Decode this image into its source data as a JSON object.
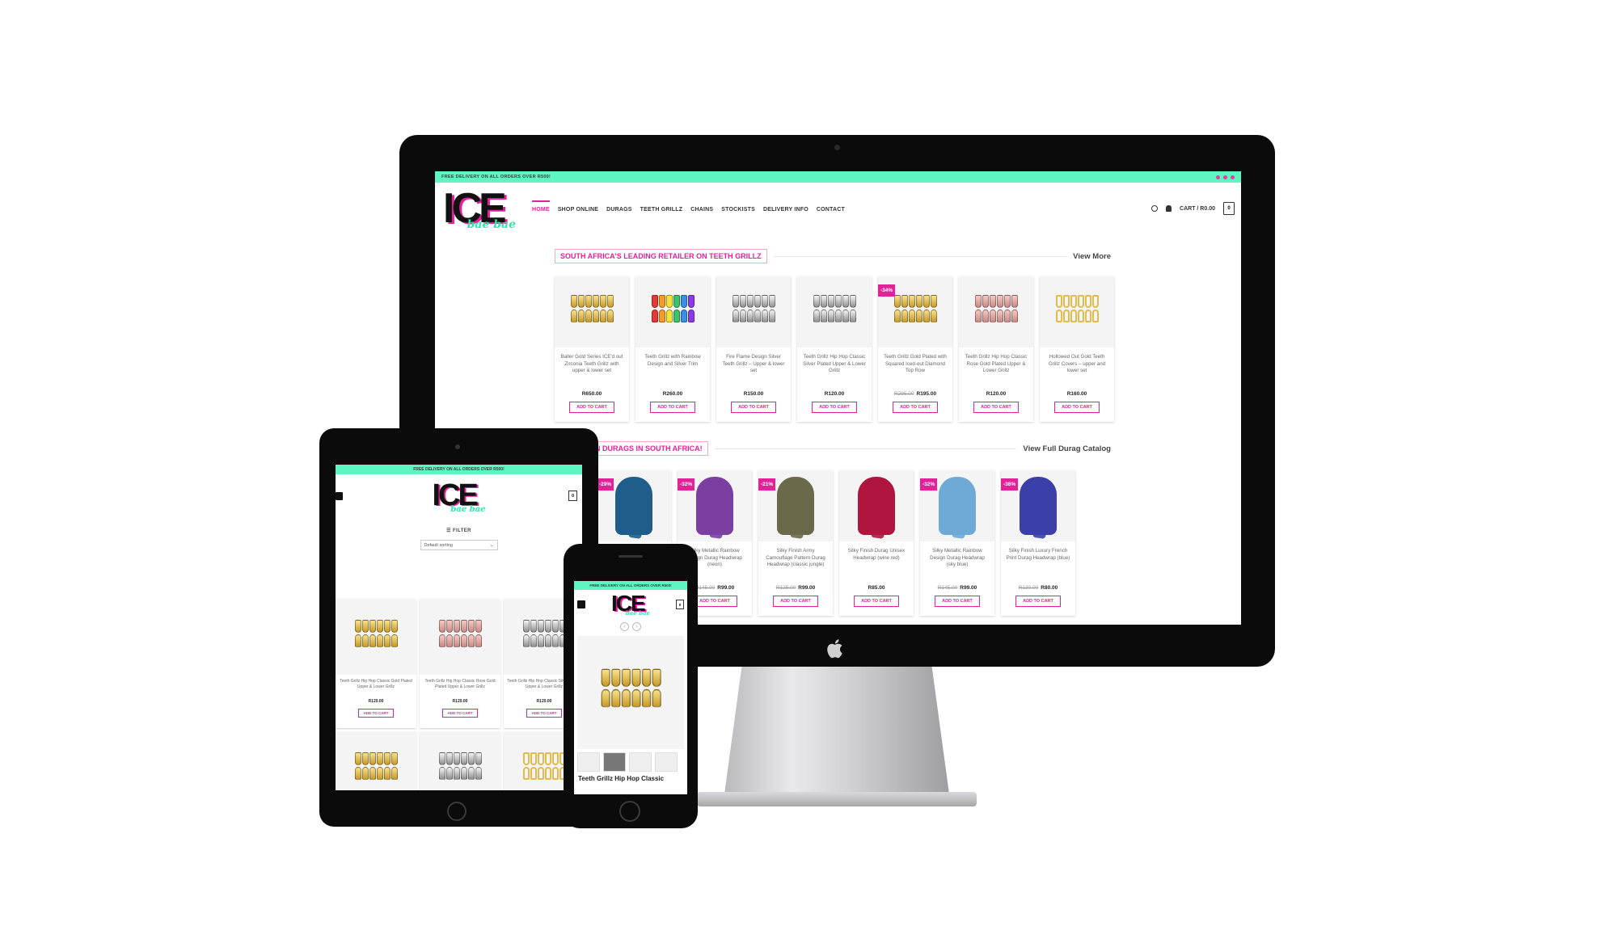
{
  "desktop": {
    "topbar": {
      "promo": "FREE DELIVERY ON ALL ORDERS OVER R500!"
    },
    "logo": {
      "word": "ICE",
      "script": "bae bae"
    },
    "nav": [
      "HOME",
      "SHOP ONLINE",
      "DURAGS",
      "TEETH GRILLZ",
      "CHAINS",
      "STOCKISTS",
      "DELIVERY INFO",
      "CONTACT"
    ],
    "cart_label": "CART / R0.00",
    "cart_count": "0",
    "section1": {
      "title": "SOUTH AFRICA'S LEADING RETAILER ON TEETH GRILLZ",
      "link": "View More",
      "products": [
        {
          "name": "Baller Gold Series ICE'd out Zirconia Teeth Grillz with upper & lower set",
          "price": "R650.00",
          "old": "",
          "badge": "",
          "style": "gold"
        },
        {
          "name": "Teeth Grillz with Rainbow Design and Silver Trim",
          "price": "R260.00",
          "old": "",
          "badge": "",
          "style": "rainbow"
        },
        {
          "name": "Fire Flame Design Silver Teeth Grillz – Upper & lower set",
          "price": "R150.00",
          "old": "",
          "badge": "",
          "style": "silver"
        },
        {
          "name": "Teeth Grillz Hip Hop Classic Silver Plated Upper & Lower Grillz",
          "price": "R120.00",
          "old": "",
          "badge": "",
          "style": "silver"
        },
        {
          "name": "Teeth Grillz Gold Plated with Squared Iced-out Diamond Top Row",
          "price": "R195.00",
          "old": "R295.00",
          "badge": "-34%",
          "style": "gold"
        },
        {
          "name": "Teeth Grillz Hip Hop Classic Rose Gold Plated Upper & Lower Grillz",
          "price": "R120.00",
          "old": "",
          "badge": "",
          "style": "rose"
        },
        {
          "name": "Hollowed Out Gold Teeth Grillz Covers – upper and lower set",
          "price": "R160.00",
          "old": "",
          "badge": "",
          "style": "open"
        }
      ]
    },
    "section2": {
      "title": "PRICES ON DURAGS IN SOUTH AFRICA!",
      "link": "View Full Durag Catalog",
      "products": [
        {
          "name": "",
          "price": "",
          "old": "",
          "badge": "-29%",
          "color": "#1f5e8a"
        },
        {
          "name": "Silky Metallic Rainbow Design Durag Headwrap (neon)",
          "price": "R99.00",
          "old": "R145.00",
          "badge": "-32%",
          "color": "#7a3fa0"
        },
        {
          "name": "Silky Finish Army Camouflage Pattern Durag Headwrap (classic jungle)",
          "price": "R99.00",
          "old": "R125.00",
          "badge": "-21%",
          "color": "#6a6a4a"
        },
        {
          "name": "Silky Finish Durag Unisex Headwrap (wine red)",
          "price": "R85.00",
          "old": "",
          "badge": "",
          "color": "#b0163d"
        },
        {
          "name": "Silky Metallic Rainbow Design Durag Headwrap (sky blue)",
          "price": "R99.00",
          "old": "R145.00",
          "badge": "-32%",
          "color": "#6fa9d6"
        },
        {
          "name": "Silky Finish Luxury French Print Durag Headwrap (blue)",
          "price": "R80.00",
          "old": "R130.00",
          "badge": "-38%",
          "color": "#3b3fa8"
        }
      ]
    },
    "atc_label": "ADD TO CART"
  },
  "tablet": {
    "promo": "FREE DELIVERY ON ALL ORDERS OVER R500!",
    "cart_count": "0",
    "filter": "FILTER",
    "sort": "Default sorting",
    "products": [
      {
        "name": "Teeth Grillz Hip Hop Classic Gold Plated Upper & Lower Grillz",
        "price": "R120.00",
        "style": "gold"
      },
      {
        "name": "Teeth Grillz Hip Hop Classic Rose Gold Plated Upper & Lower Grillz",
        "price": "R120.00",
        "style": "rose"
      },
      {
        "name": "Teeth Grillz Hip Hop Classic Silver Plated Upper & Lower Grillz",
        "price": "R120.00",
        "style": "silver"
      },
      {
        "name": "",
        "price": "",
        "style": "gold"
      },
      {
        "name": "",
        "price": "",
        "style": "silver"
      },
      {
        "name": "",
        "price": "",
        "style": "open"
      }
    ],
    "atc_label": "ADD TO CART"
  },
  "phone": {
    "promo": "FREE DELIVERY ON ALL ORDERS OVER R500!",
    "cart_count": "0",
    "product_title": "Teeth Grillz Hip Hop Classic"
  },
  "colors": {
    "accent": "#e3229a",
    "topbar": "#5ff5c2"
  }
}
